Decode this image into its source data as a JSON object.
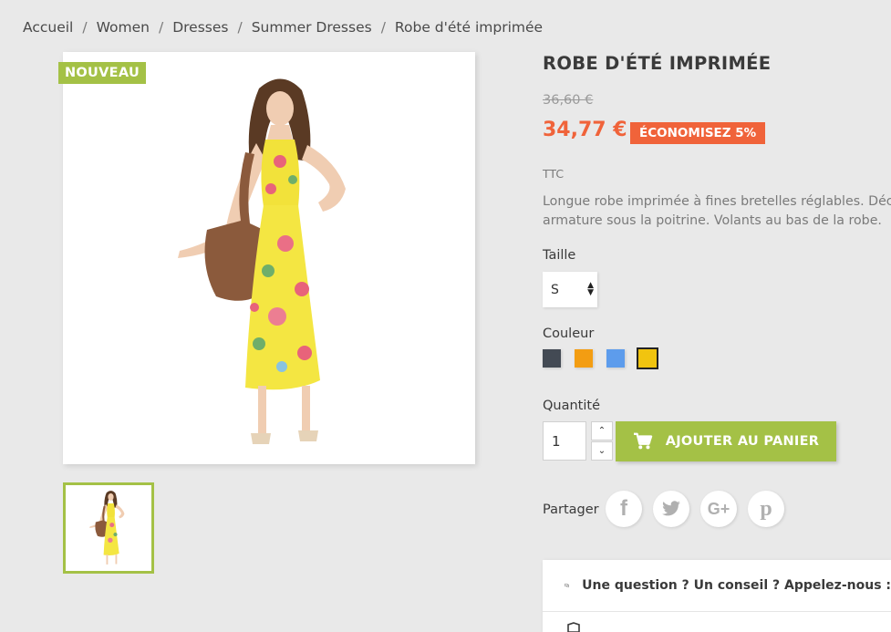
{
  "breadcrumb": [
    "Accueil",
    "Women",
    "Dresses",
    "Summer Dresses",
    "Robe d'été imprimée"
  ],
  "product": {
    "badge": "NOUVEAU",
    "title": "ROBE D'ÉTÉ IMPRIMÉE",
    "old_price": "36,60 €",
    "price": "34,77 €",
    "discount": "ÉCONOMISEZ 5%",
    "tax_label": "TTC",
    "description_line1": "Longue robe imprimée à fines bretelles réglables. Déco",
    "description_line2": "armature sous la poitrine. Volants au bas de la robe."
  },
  "size": {
    "label": "Taille",
    "value": "S"
  },
  "color": {
    "label": "Couleur",
    "swatches": [
      "#434a54",
      "#f39d12",
      "#5d9cec",
      "#f1c40f"
    ],
    "selected_index": 3
  },
  "quantity": {
    "label": "Quantité",
    "value": "1"
  },
  "add_to_cart": {
    "label": "AJOUTER AU PANIER",
    "icon": "cart-icon"
  },
  "share": {
    "label": "Partager",
    "networks": [
      "facebook-icon",
      "twitter-icon",
      "google-plus-icon",
      "pinterest-icon"
    ]
  },
  "reassurance": {
    "text": "Une question ? Un conseil ? Appelez-nous :",
    "icon": "chat-bubbles-icon"
  },
  "colors": {
    "accent": "#a4c146",
    "sale": "#f0633a",
    "background": "#e9e9e9"
  }
}
